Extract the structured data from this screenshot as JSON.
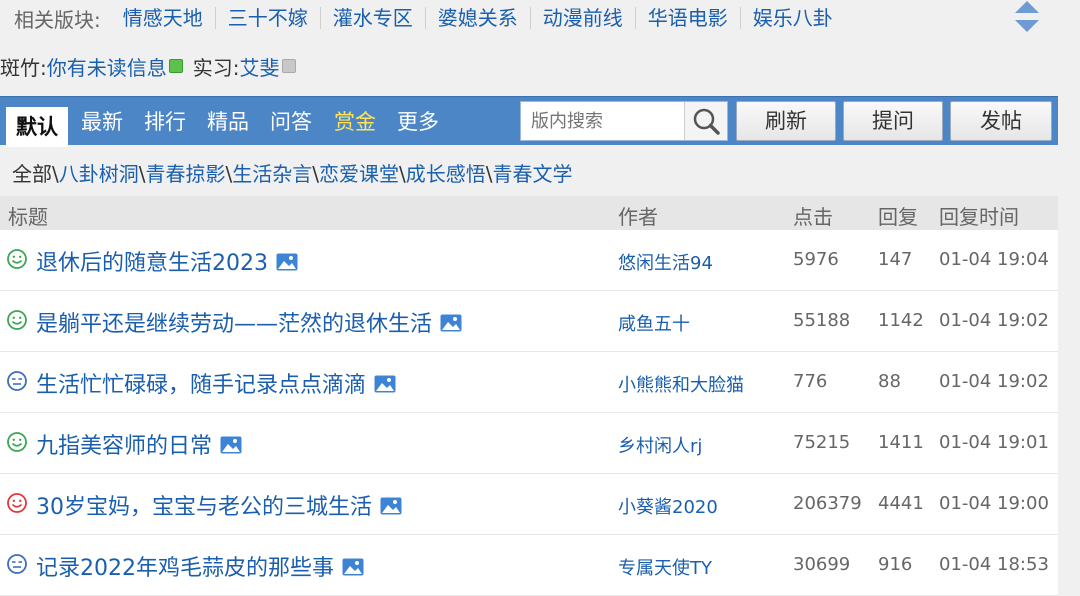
{
  "related": {
    "label": "相关版块:",
    "items": [
      "情感天地",
      "三十不嫁",
      "灌水专区",
      "婆媳关系",
      "动漫前线",
      "华语电影",
      "娱乐八卦"
    ]
  },
  "moderators": {
    "prefix": "斑竹:",
    "notice": "你有未读信息",
    "intern_label": "实习:",
    "intern_name": "艾斐"
  },
  "tabs": {
    "items": [
      "默认",
      "最新",
      "排行",
      "精品",
      "问答",
      "赏金",
      "更多"
    ],
    "active": "默认"
  },
  "search": {
    "placeholder": "版内搜索"
  },
  "buttons": {
    "refresh": "刷新",
    "ask": "提问",
    "post": "发帖"
  },
  "categories": {
    "all": "全部",
    "items": [
      "八卦树洞",
      "青春掠影",
      "生活杂言",
      "恋爱课堂",
      "成长感悟",
      "青春文学"
    ]
  },
  "table": {
    "headers": {
      "title": "标题",
      "author": "作者",
      "clicks": "点击",
      "replies": "回复",
      "reply_time": "回复时间"
    },
    "rows": [
      {
        "icon": "smile-green-icon",
        "title": "退休后的随意生活2023",
        "author": "悠闲生活94",
        "clicks": "5976",
        "replies": "147",
        "time": "01-04 19:04"
      },
      {
        "icon": "smile-green-icon",
        "title": "是躺平还是继续劳动——茫然的退休生活",
        "author": "咸鱼五十",
        "clicks": "55188",
        "replies": "1142",
        "time": "01-04 19:02"
      },
      {
        "icon": "neutral-blue-icon",
        "title": "生活忙忙碌碌，随手记录点点滴滴",
        "author": "小熊熊和大脸猫",
        "clicks": "776",
        "replies": "88",
        "time": "01-04 19:02"
      },
      {
        "icon": "smile-green-icon",
        "title": "九指美容师的日常",
        "author": "乡村闲人rj",
        "clicks": "75215",
        "replies": "1411",
        "time": "01-04 19:01"
      },
      {
        "icon": "smile-red-icon",
        "title": "30岁宝妈，宝宝与老公的三城生活",
        "author": "小葵酱2020",
        "clicks": "206379",
        "replies": "4441",
        "time": "01-04 19:00"
      },
      {
        "icon": "neutral-blue-icon",
        "title": "记录2022年鸡毛蒜皮的那些事",
        "author": "专属天使TY",
        "clicks": "30699",
        "replies": "916",
        "time": "01-04 18:53"
      }
    ]
  },
  "colors": {
    "link": "#1a5fae",
    "tabbar": "#4c86c6",
    "gold_tab": "#ffe35a",
    "smile_green": "#3aa655",
    "smile_red": "#e0393c",
    "neutral_blue": "#3b6fc0"
  }
}
